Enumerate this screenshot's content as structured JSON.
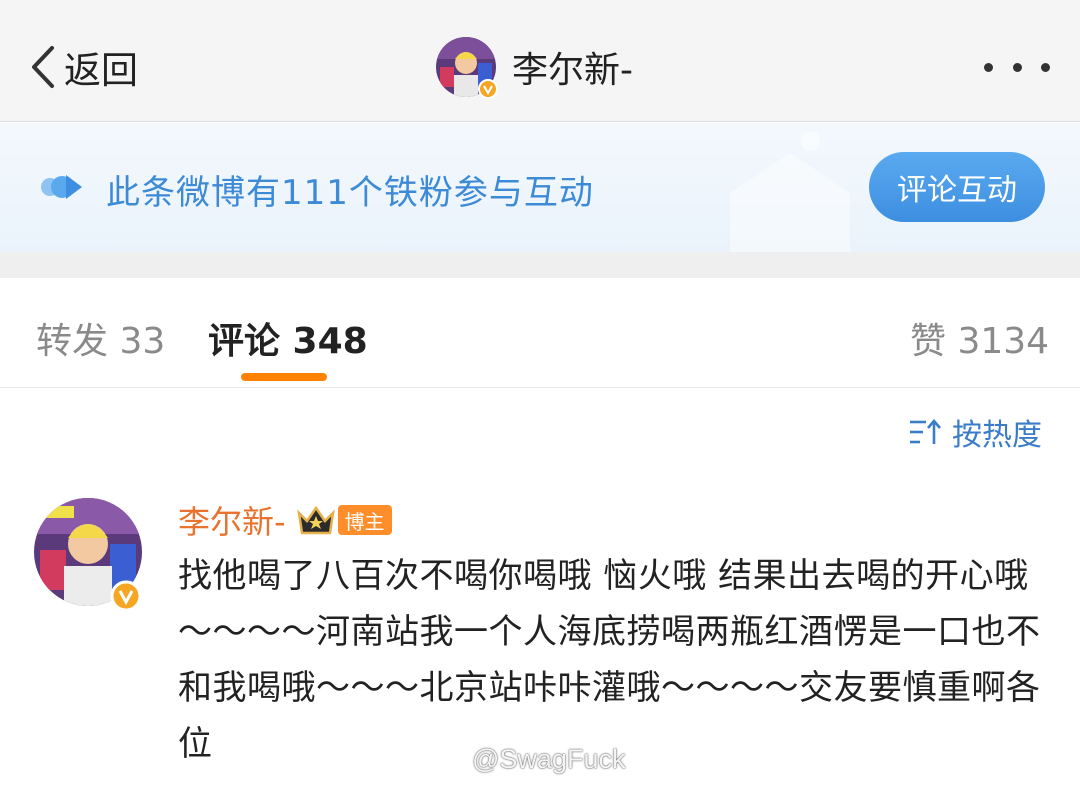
{
  "nav": {
    "back_label": "返回",
    "title": "李尔新-",
    "more_icon": "more-dots-icon"
  },
  "banner": {
    "text": "此条微博有111个铁粉参与互动",
    "button_label": "评论互动"
  },
  "tabs": {
    "repost": "转发 33",
    "comment": "评论 348",
    "like": "赞 3134"
  },
  "sort": {
    "label": "按热度"
  },
  "comment": {
    "author": "李尔新-",
    "badge": "博主",
    "text": "找他喝了八百次不喝你喝哦 恼火哦 结果出去喝的开心哦～～～～河南站我一个人海底捞喝两瓶红酒愣是一口也不和我喝哦～～～北京站咔咔灌哦～～～～交友要慎重啊各位"
  },
  "watermark": {
    "text": "@SwagFuck"
  },
  "colors": {
    "accent_orange": "#ff8200",
    "link_blue": "#3b7cc8",
    "banner_blue": "#3d8ad7",
    "author_orange": "#e8722e"
  }
}
